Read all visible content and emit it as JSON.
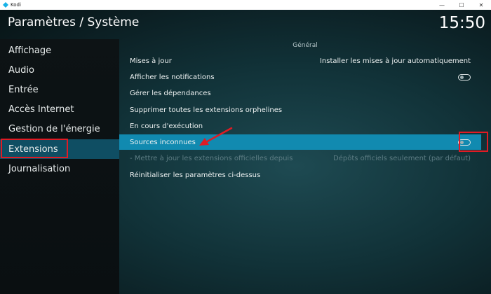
{
  "window": {
    "title": "Kodi",
    "minimize_glyph": "—",
    "maximize_glyph": "☐",
    "close_glyph": "✕"
  },
  "header": {
    "title": "Paramètres / Système",
    "clock": "15:50"
  },
  "sidebar": {
    "items": [
      {
        "label": "Affichage"
      },
      {
        "label": "Audio"
      },
      {
        "label": "Entrée"
      },
      {
        "label": "Accès Internet"
      },
      {
        "label": "Gestion de l'énergie"
      },
      {
        "label": "Extensions"
      },
      {
        "label": "Journalisation"
      }
    ],
    "active_index": 5
  },
  "settings": {
    "section_title": "Général",
    "rows": [
      {
        "label": "Mises à jour",
        "value": "Installer les mises à jour automatiquement"
      },
      {
        "label": "Afficher les notifications",
        "toggle": "off"
      },
      {
        "label": "Gérer les dépendances"
      },
      {
        "label": "Supprimer toutes les extensions orphelines"
      },
      {
        "label": "En cours d'exécution"
      },
      {
        "label": "Sources inconnues",
        "toggle": "off",
        "focused": true
      },
      {
        "label": "- Mettre à jour les extensions officielles depuis",
        "value": "Dépôts officiels seulement (par défaut)",
        "disabled": true
      },
      {
        "label": "Réinitialiser les paramètres ci-dessus"
      }
    ]
  },
  "colors": {
    "highlight": "#118ab0",
    "sidebar_active": "#0f4e63",
    "annotation_red": "#e01b24"
  }
}
